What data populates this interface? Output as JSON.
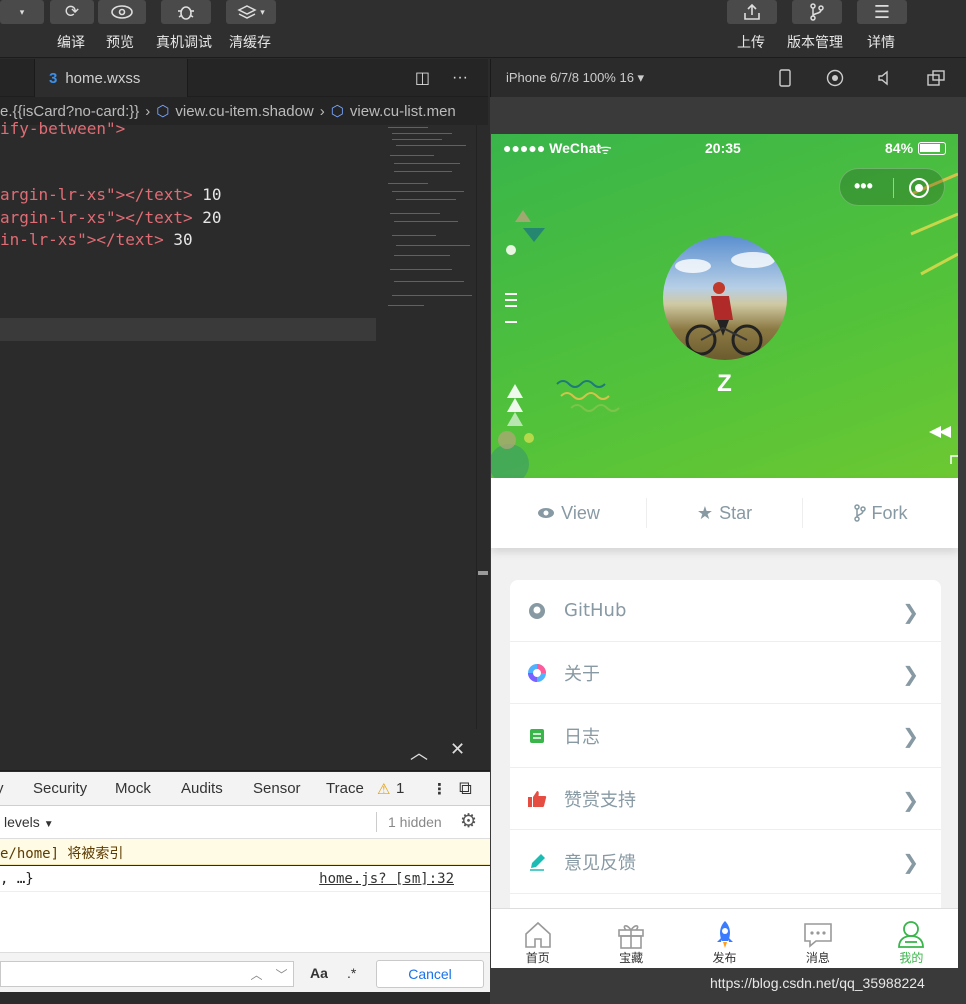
{
  "toolbar": {
    "left_labels": [
      "编译",
      "预览",
      "真机调试",
      "清缓存"
    ],
    "right_labels": [
      "上传",
      "版本管理",
      "详情"
    ]
  },
  "editor": {
    "tab_label": "home.wxss",
    "breadcrumb": [
      "e.{{isCard?no-card:}}",
      "view.cu-item.shadow",
      "view.cu-list.men"
    ],
    "lines": [
      {
        "text": "ify-between\">",
        "value": ""
      },
      {
        "text": "argin-lr-xs\"></text>",
        "value": "10"
      },
      {
        "text": "argin-lr-xs\"></text>",
        "value": "20"
      },
      {
        "text": "in-lr-xs\"></text>",
        "value": "30"
      }
    ]
  },
  "console": {
    "tabs": [
      "y",
      "Security",
      "Mock",
      "Audits",
      "Sensor",
      "Trace"
    ],
    "warning_count": "1",
    "levels_label": "levels",
    "hidden_label": "1 hidden",
    "warning_text": "e/home] 将被索引",
    "log_text": ", …}",
    "log_source": "home.js? [sm]:32",
    "find": {
      "case_label": "Aa",
      "regex_label": ".*",
      "cancel_label": "Cancel"
    }
  },
  "simulator": {
    "device_label": "iPhone 6/7/8 100% 16 ▾",
    "status": {
      "carrier": "●●●●● WeChat",
      "time": "20:35",
      "battery": "84%"
    },
    "username": "Z",
    "stats": [
      {
        "label": "View",
        "icon": "eye-icon"
      },
      {
        "label": "Star",
        "icon": "star-icon"
      },
      {
        "label": "Fork",
        "icon": "fork-icon"
      }
    ],
    "menu": [
      {
        "label": "GitHub",
        "icon": "github-icon",
        "color": "#8799a3"
      },
      {
        "label": "关于",
        "icon": "logo-icon",
        "color": "#7b61ff"
      },
      {
        "label": "日志",
        "icon": "log-icon",
        "color": "#39b54a"
      },
      {
        "label": "赞赏支持",
        "icon": "thumb-icon",
        "color": "#e54d42"
      },
      {
        "label": "意见反馈",
        "icon": "pen-icon",
        "color": "#1cbbb4"
      }
    ],
    "tabs": [
      {
        "label": "首页",
        "icon": "home-icon"
      },
      {
        "label": "宝藏",
        "icon": "gift-icon"
      },
      {
        "label": "发布",
        "icon": "rocket-icon"
      },
      {
        "label": "消息",
        "icon": "message-icon"
      },
      {
        "label": "我的",
        "icon": "user-icon",
        "active": true
      }
    ]
  },
  "watermark": "https://blog.csdn.net/qq_35988224",
  "colors": {
    "accent": "#39b54a",
    "text_muted": "#8799a3"
  }
}
